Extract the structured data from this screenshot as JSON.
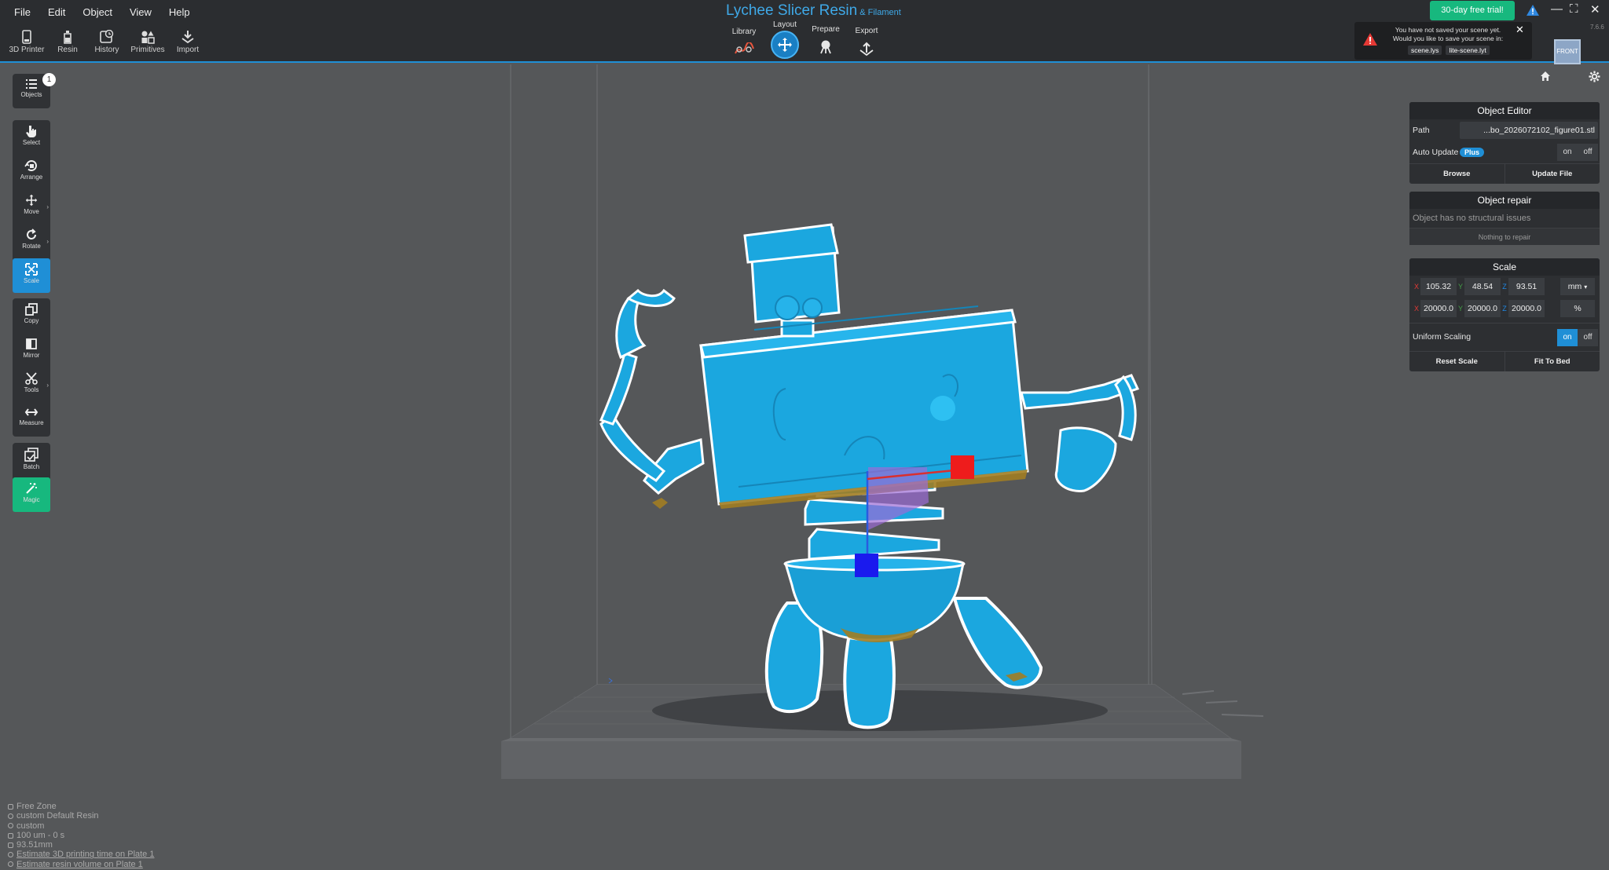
{
  "app": {
    "title": "Lychee Slicer Resin",
    "subtitle": "& Filament",
    "version": "7.6.6"
  },
  "menu": [
    "File",
    "Edit",
    "Object",
    "View",
    "Help"
  ],
  "toolbar": {
    "printer": "3D Printer",
    "resin": "Resin",
    "history": "History",
    "primitives": "Primitives",
    "import": "Import"
  },
  "modes": {
    "library": "Library",
    "layout": "Layout",
    "prepare": "Prepare",
    "export": "Export",
    "active": "Layout"
  },
  "trial_button": "30-day free trial!",
  "notification": {
    "text": "You have not saved your scene yet. Would you like to save your scene in:",
    "options": [
      "scene.lys",
      "lite-scene.lyt"
    ]
  },
  "view_cube_label": "FRONT",
  "left_tools": {
    "objects": "Objects",
    "objects_count": "1",
    "select": "Select",
    "arrange": "Arrange",
    "move": "Move",
    "rotate": "Rotate",
    "scale": "Scale",
    "copy": "Copy",
    "mirror": "Mirror",
    "tools": "Tools",
    "measure": "Measure",
    "batch": "Batch",
    "magic": "Magic",
    "active": "Scale"
  },
  "object_editor": {
    "title": "Object Editor",
    "path_label": "Path",
    "path_value": "...bo_2026072102_figure01.stl",
    "auto_update_label": "Auto Update",
    "plus_badge": "Plus",
    "on": "on",
    "off": "off",
    "auto_update_state": "off",
    "browse": "Browse",
    "update_file": "Update File"
  },
  "object_repair": {
    "title": "Object repair",
    "message": "Object has no structural issues",
    "button": "Nothing to repair"
  },
  "scale": {
    "title": "Scale",
    "x_label": "X",
    "y_label": "Y",
    "z_label": "Z",
    "x_mm": "105.32",
    "y_mm": "48.54",
    "z_mm": "93.51",
    "unit_mm": "mm",
    "x_pct": "20000.0",
    "y_pct": "20000.0",
    "z_pct": "20000.0",
    "unit_pct": "%",
    "uniform_label": "Uniform Scaling",
    "uniform_state": "on",
    "on": "on",
    "off": "off",
    "reset": "Reset Scale",
    "fit": "Fit To Bed",
    "x_color": "#e53935",
    "y_color": "#43a047",
    "z_color": "#1e88e5"
  },
  "status": {
    "zone": "Free Zone",
    "resin": "custom Default Resin",
    "profile": "custom",
    "layer": "100 um - 0 s",
    "height": "93.51mm",
    "estimate_time": "Estimate 3D printing time on Plate 1",
    "estimate_volume": "Estimate resin volume on Plate 1"
  },
  "colors": {
    "accent": "#1f8fd6",
    "model": "#1ba7df",
    "trial": "#17b87e",
    "background": "#555759",
    "toolbar": "#2b2d30"
  }
}
